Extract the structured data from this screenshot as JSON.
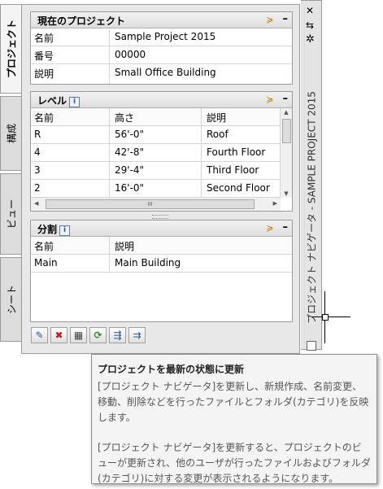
{
  "palette": {
    "panel_bg": "#e8e8e8",
    "header_bg": "#dedede",
    "border": "#9a9a9a",
    "tooltip_bg": "#f4f4f4",
    "refresh_green": "#2e8b2e"
  },
  "tabs": [
    {
      "label": "プロジェクト",
      "active": true
    },
    {
      "label": "構成",
      "active": false
    },
    {
      "label": "ビュー",
      "active": false
    },
    {
      "label": "シート",
      "active": false
    }
  ],
  "current_project": {
    "title": "現在のプロジェクト",
    "rows": [
      {
        "label": "名前",
        "value": "Sample Project 2015"
      },
      {
        "label": "番号",
        "value": "00000"
      },
      {
        "label": "説明",
        "value": "Small Office Building"
      }
    ]
  },
  "levels": {
    "title": "レベル",
    "info_icon": "i",
    "columns": [
      "名前",
      "高さ",
      "説明"
    ],
    "rows": [
      {
        "name": "R",
        "height": "56'-0\"",
        "desc": "Roof"
      },
      {
        "name": "4",
        "height": "42'-8\"",
        "desc": "Fourth Floor"
      },
      {
        "name": "3",
        "height": "29'-4\"",
        "desc": "Third Floor"
      },
      {
        "name": "2",
        "height": "16'-0\"",
        "desc": "Second Floor"
      }
    ],
    "hscroll_thumb": "III"
  },
  "divisions": {
    "title": "分割",
    "info_icon": "i",
    "columns": [
      "名前",
      "説明"
    ],
    "rows": [
      {
        "name": "Main",
        "desc": "Main Building"
      }
    ]
  },
  "icons": {
    "settings": "≽",
    "minimize": "–",
    "close": "✕",
    "pin": "⇆",
    "properties": "✲",
    "scroll_up": "▲",
    "scroll_down": "▼",
    "scroll_left": "◀",
    "scroll_right": "▶"
  },
  "palette_title": "プロジェクト ナビゲータ - SAMPLE PROJECT 2015",
  "toolbar": [
    "✎",
    "✖",
    "▦",
    "⟳",
    "⇶",
    "⇉"
  ],
  "tooltip": {
    "title": "プロジェクトを最新の状態に更新",
    "body1": "[プロジェクト ナビゲータ]を更新し、新規作成、名前変更、移動、削除などを行ったファイルとフォルダ(カテゴリ)を反映します。",
    "body2": "[プロジェクト ナビゲータ]を更新すると、プロジェクトのビューが更新され、他のユーザが行ったファイルおよびフォルダ(カテゴリ)に対する変更が表示されるようになります。"
  }
}
